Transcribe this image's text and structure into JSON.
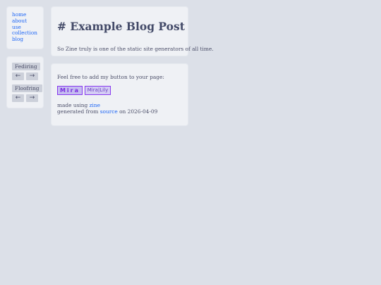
{
  "nav": {
    "items": [
      "home",
      "about",
      "use",
      "collection",
      "blog"
    ]
  },
  "webrings": [
    {
      "label": "Fediring",
      "prev": "←",
      "next": "→"
    },
    {
      "label": "Floofring",
      "prev": "←",
      "next": "→"
    }
  ],
  "post": {
    "title": "# Example Blog Post",
    "body": "So Zine truly is one of the static site generators of all time."
  },
  "footer": {
    "intro": "Feel free to add my button to your page:",
    "badge_mira": "Mira",
    "badge_mira_lily": "Mira|Lily",
    "made_using_prefix": "made using ",
    "made_using_link": "zine",
    "generated_prefix": "generated from ",
    "generated_link": "source",
    "generated_suffix": " on 2026-04-09"
  },
  "colors": {
    "background": "#dce0e8",
    "card": "#eff1f5",
    "link": "#1e66f5",
    "text": "#4c4f69",
    "badge_border": "#8839ef"
  }
}
